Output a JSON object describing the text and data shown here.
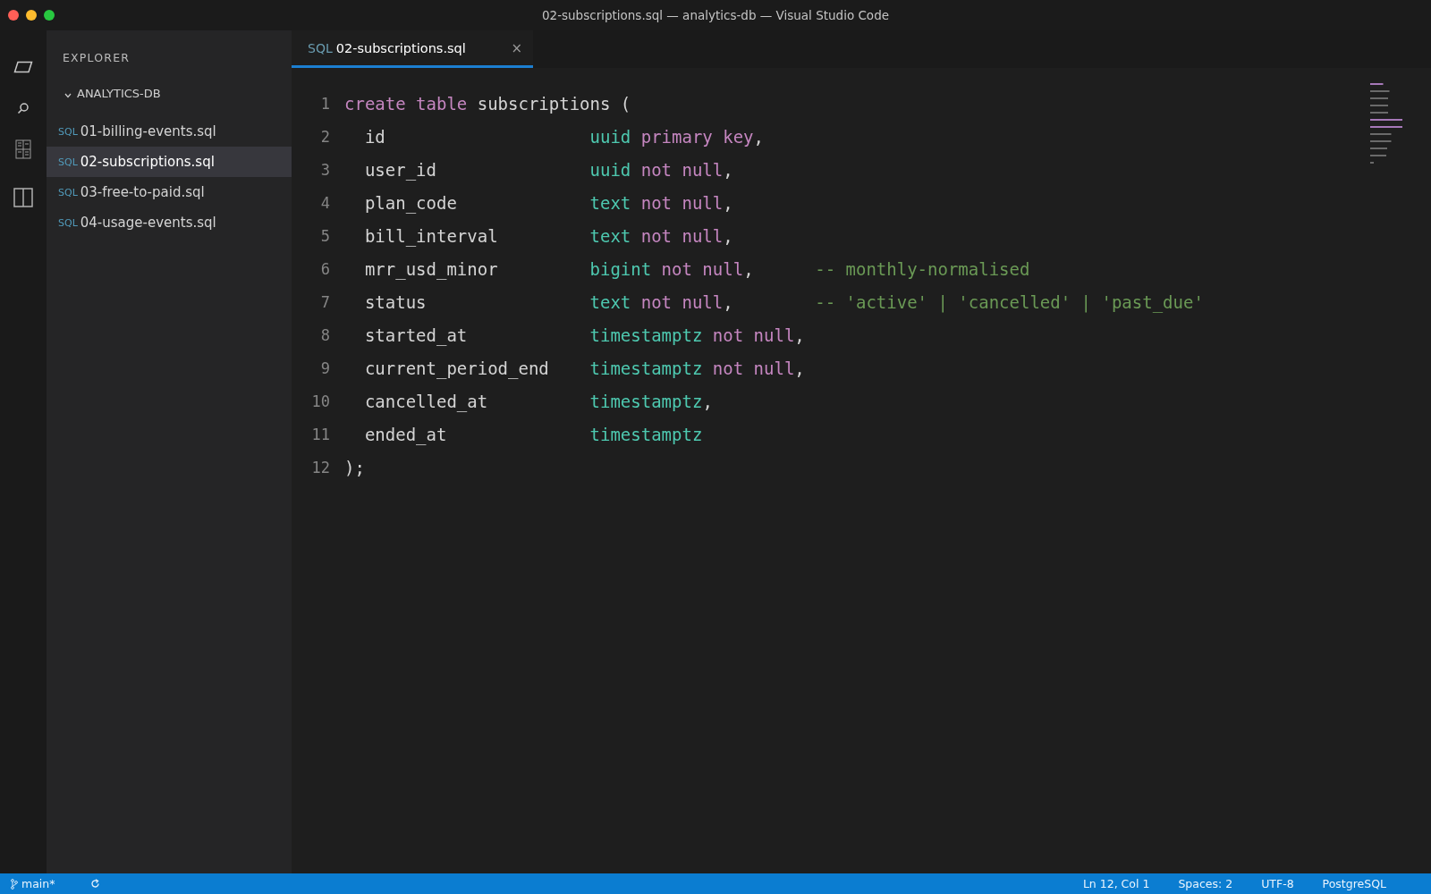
{
  "window": {
    "title": "02-subscriptions.sql — analytics-db — Visual Studio Code"
  },
  "sidebar": {
    "title": "EXPLORER",
    "folder": {
      "name": "ANALYTICS-DB",
      "expanded": true
    },
    "files": [
      {
        "badge": "SQL",
        "name": "01-billing-events.sql",
        "selected": false
      },
      {
        "badge": "SQL",
        "name": "02-subscriptions.sql",
        "selected": true
      },
      {
        "badge": "SQL",
        "name": "03-free-to-paid.sql",
        "selected": false
      },
      {
        "badge": "SQL",
        "name": "04-usage-events.sql",
        "selected": false
      }
    ]
  },
  "tabs": [
    {
      "badge": "SQL",
      "label": "02-subscriptions.sql",
      "selected": true,
      "close": "×"
    }
  ],
  "editor": {
    "lines": [
      {
        "number": "1",
        "kind": "statement",
        "tokens": [
          {
            "text": "create table",
            "kind": "keyword"
          },
          {
            "text": "subscriptions (",
            "kind": "plain"
          }
        ]
      },
      {
        "number": "2",
        "kind": "column",
        "name": "id",
        "tokens": [
          {
            "text": "uuid",
            "kind": "type"
          },
          {
            "text": "primary key",
            "kind": "keyword"
          },
          {
            "text": ",",
            "kind": "punct"
          }
        ]
      },
      {
        "number": "3",
        "kind": "column",
        "name": "user_id",
        "tokens": [
          {
            "text": "uuid",
            "kind": "type"
          },
          {
            "text": "not null",
            "kind": "keyword"
          },
          {
            "text": ",",
            "kind": "punct"
          }
        ]
      },
      {
        "number": "4",
        "kind": "column",
        "name": "plan_code",
        "tokens": [
          {
            "text": "text",
            "kind": "type"
          },
          {
            "text": "not null",
            "kind": "keyword"
          },
          {
            "text": ",",
            "kind": "punct"
          }
        ]
      },
      {
        "number": "5",
        "kind": "column",
        "name": "bill_interval",
        "tokens": [
          {
            "text": "text",
            "kind": "type"
          },
          {
            "text": "not null",
            "kind": "keyword"
          },
          {
            "text": ",",
            "kind": "punct"
          }
        ]
      },
      {
        "number": "6",
        "kind": "column",
        "name": "mrr_usd_minor",
        "tokens": [
          {
            "text": "bigint",
            "kind": "type"
          },
          {
            "text": "not null",
            "kind": "keyword"
          },
          {
            "text": ",",
            "kind": "punct"
          }
        ],
        "comment": "-- monthly-normalised"
      },
      {
        "number": "7",
        "kind": "column",
        "name": "status",
        "tokens": [
          {
            "text": "text",
            "kind": "type"
          },
          {
            "text": "not null",
            "kind": "keyword"
          },
          {
            "text": ",",
            "kind": "punct"
          }
        ],
        "comment": "-- 'active' | 'cancelled' | 'past_due'"
      },
      {
        "number": "8",
        "kind": "column",
        "name": "started_at",
        "tokens": [
          {
            "text": "timestamptz",
            "kind": "type"
          },
          {
            "text": "not null",
            "kind": "keyword"
          },
          {
            "text": ",",
            "kind": "punct"
          }
        ]
      },
      {
        "number": "9",
        "kind": "column",
        "name": "current_period_end",
        "tokens": [
          {
            "text": "timestamptz",
            "kind": "type"
          },
          {
            "text": "not null",
            "kind": "keyword"
          },
          {
            "text": ",",
            "kind": "punct"
          }
        ]
      },
      {
        "number": "10",
        "kind": "column",
        "name": "cancelled_at",
        "tokens": [
          {
            "text": "timestamptz",
            "kind": "type"
          },
          {
            "text": ",",
            "kind": "punct"
          }
        ]
      },
      {
        "number": "11",
        "kind": "column",
        "name": "ended_at",
        "tokens": [
          {
            "text": "timestamptz",
            "kind": "type"
          }
        ]
      },
      {
        "number": "12",
        "kind": "statement",
        "tokens": [
          {
            "text": ");",
            "kind": "plain"
          }
        ]
      }
    ]
  },
  "status_bar": {
    "branch": "main*",
    "position": "Ln 12, Col 1",
    "indentation": "Spaces: 2",
    "encoding": "UTF-8",
    "language": "PostgreSQL"
  }
}
